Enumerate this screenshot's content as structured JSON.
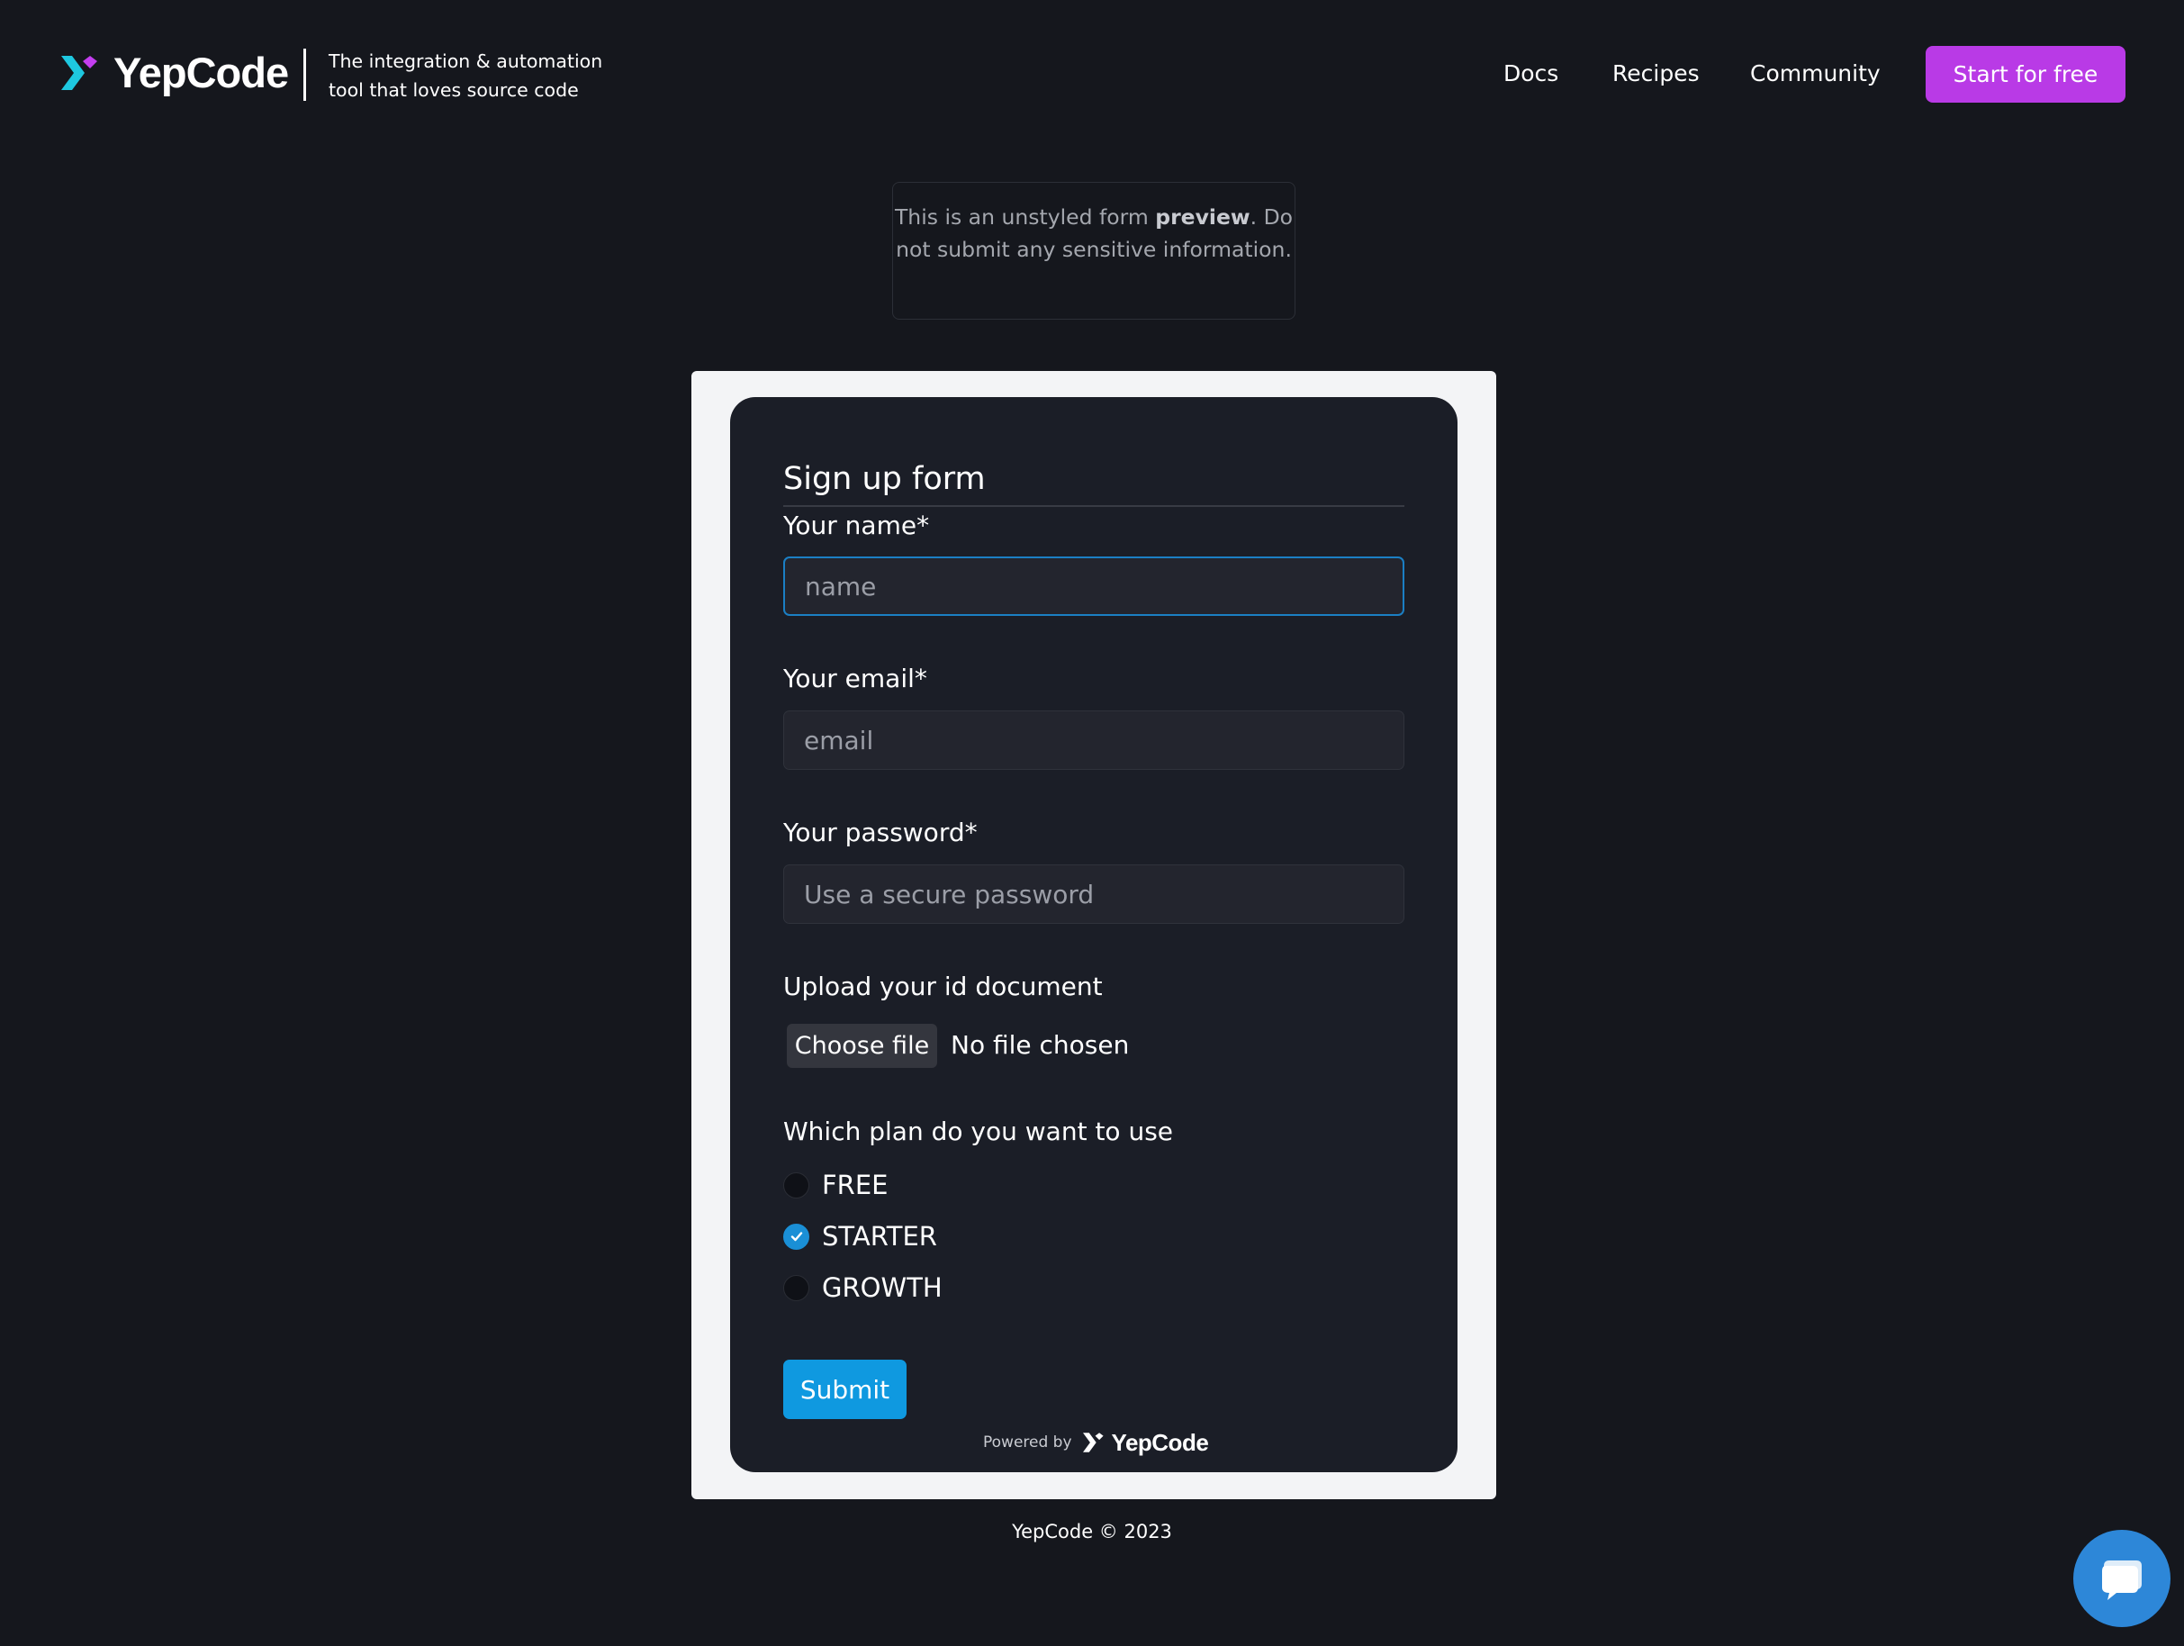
{
  "header": {
    "brand": "YepCode",
    "tagline_line1": "The integration & automation",
    "tagline_line2": "tool that loves source code",
    "nav": {
      "docs": "Docs",
      "recipes": "Recipes",
      "community": "Community"
    },
    "cta_label": "Start for free"
  },
  "notice": {
    "prefix": "This is an unstyled form ",
    "bold": "preview",
    "suffix": ". Do not submit any sensitive information."
  },
  "form": {
    "title": "Sign up form",
    "name": {
      "label": "Your name*",
      "placeholder": "name",
      "value": ""
    },
    "email": {
      "label": "Your email*",
      "placeholder": "email",
      "value": ""
    },
    "password": {
      "label": "Your password*",
      "placeholder": "Use a secure password",
      "value": ""
    },
    "upload": {
      "label": "Upload your id document",
      "button": "Choose file",
      "status": "No file chosen"
    },
    "plan": {
      "label": "Which plan do you want to use",
      "options": [
        "FREE",
        "STARTER",
        "GROWTH"
      ],
      "selected": "STARTER"
    },
    "submit_label": "Submit",
    "powered_by": "Powered by",
    "powered_brand": "YepCode"
  },
  "footer": {
    "text": "YepCode © 2023"
  },
  "colors": {
    "background": "#15171d",
    "card": "#1b1e27",
    "frame": "#f3f4f6",
    "cta": "#b93ae6",
    "submit": "#0f99e0",
    "radio_checked": "#1a8fd6",
    "logo_cyan": "#1ec8e0",
    "logo_magenta": "#c43ef0",
    "chat": "#2d87d8"
  },
  "icons": {
    "logo": "yepcode-chevron-icon",
    "radio_check": "check-icon",
    "chat": "chat-bubble-icon"
  }
}
